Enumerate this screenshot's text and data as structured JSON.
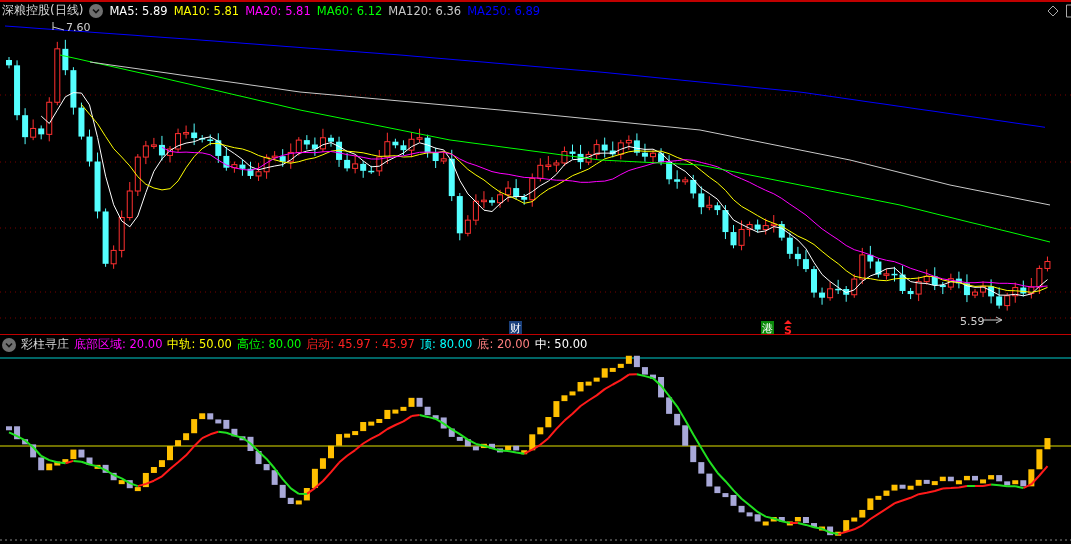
{
  "chart_title": "深粮控股(日线)",
  "ma_legend": [
    {
      "label": "MA5: 5.89",
      "color": "#ffffff"
    },
    {
      "label": "MA10: 5.81",
      "color": "#ffff00"
    },
    {
      "label": "MA20: 5.81",
      "color": "#ff00ff"
    },
    {
      "label": "MA60: 6.12",
      "color": "#00ff00"
    },
    {
      "label": "MA120: 6.36",
      "color": "#c8c8c8"
    },
    {
      "label": "MA250: 6.89",
      "color": "#0000ff"
    }
  ],
  "price_labels": {
    "high": "7.60",
    "low": "5.59"
  },
  "event_markers": [
    {
      "text": "财",
      "color": "#1a3f7a"
    },
    {
      "text": "港",
      "color": "#0a8a0a"
    }
  ],
  "signal_marker": "S",
  "indicator": {
    "title": "彩柱寻庄",
    "legend": [
      {
        "label": "底部区域: 20.00",
        "color": "#ff00ff"
      },
      {
        "label": "中轨: 50.00",
        "color": "#ffff00"
      },
      {
        "label": "高位: 80.00",
        "color": "#00ff00"
      },
      {
        "label": "启动: 45.97 : 45.97",
        "color": "#ff2020"
      },
      {
        "label": "顶: 80.00",
        "color": "#00ffff"
      },
      {
        "label": "底: 20.00",
        "color": "#ff8080"
      },
      {
        "label": "中: 50.00",
        "color": "#ffffff"
      }
    ]
  }
}
